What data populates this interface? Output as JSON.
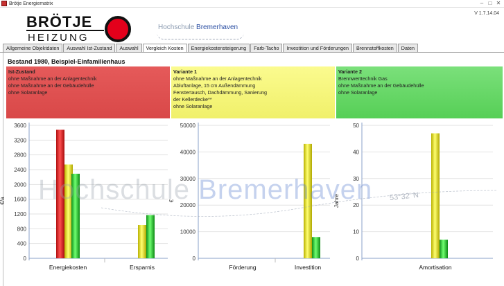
{
  "window": {
    "title": "Brötje Energiematrix",
    "controls": [
      "–",
      "□",
      "✕"
    ]
  },
  "header": {
    "logo_top": "BRÖTJE",
    "logo_bottom": "HEIZUNG",
    "hs_part1": "Hochschule",
    "hs_part2": "Bremerhaven",
    "version": "V 1.7.14.04"
  },
  "tabs": [
    {
      "label": "Allgemeine Objektdaten"
    },
    {
      "label": "Auswahl Ist-Zustand"
    },
    {
      "label": "Auswahl"
    },
    {
      "label": "Vergleich Kosten",
      "active": true
    },
    {
      "label": "Energiekostensteigerung"
    },
    {
      "label": "Farb-Tacho"
    },
    {
      "label": "Investition und Förderungen"
    },
    {
      "label": "Brennstoffkosten"
    },
    {
      "label": "Daten"
    }
  ],
  "page_title": "Bestand 1980, Beispiel-Einfamilienhaus",
  "panels": {
    "ist": {
      "title": "Ist-Zustand",
      "lines": [
        "ohne Maßnahme an der Anlagentechnik",
        "ohne Maßnahme an der Gebäudehülle",
        "ohne Solaranlage"
      ]
    },
    "v1": {
      "title": "Variante 1",
      "lines": [
        "ohne Maßnahme an der Anlagentechnik",
        "Abluftanlage, 15 cm Außendämmung",
        "Fenstertausch, Dachdämmung, Sanierung",
        "der Kellerdecke**",
        "ohne Solaranlage"
      ]
    },
    "v2": {
      "title": "Variante 2",
      "lines": [
        "Brennwerttechnik Gas",
        "ohne Maßnahme an der Gebäudehülle",
        "ohne Solaranlage"
      ]
    }
  },
  "watermark": {
    "part1": "Hochschule",
    "part2": "Bremerhaven",
    "coord": "53°32' N"
  },
  "colors": {
    "red": "#e02020",
    "yellow": "#e8e020",
    "green": "#30c030"
  },
  "chart_data": [
    {
      "type": "bar",
      "ylabel": "€/a",
      "ylim": [
        0,
        3600
      ],
      "yticks": [
        0,
        400,
        800,
        1200,
        1600,
        2000,
        2400,
        2800,
        3200,
        3600
      ],
      "categories": [
        "Energiekosten",
        "Ersparnis"
      ],
      "series": [
        {
          "color": "red",
          "values": [
            3480,
            0
          ]
        },
        {
          "color": "yellow",
          "values": [
            2540,
            900
          ]
        },
        {
          "color": "green",
          "values": [
            2290,
            1170
          ]
        }
      ]
    },
    {
      "type": "bar",
      "ylabel": "€",
      "ylim": [
        0,
        50000
      ],
      "yticks": [
        0,
        10000,
        20000,
        30000,
        40000,
        50000
      ],
      "categories": [
        "Förderung",
        "Investition"
      ],
      "series": [
        {
          "color": "red",
          "values": [
            0,
            0
          ]
        },
        {
          "color": "yellow",
          "values": [
            0,
            43000
          ]
        },
        {
          "color": "green",
          "values": [
            0,
            8000
          ]
        }
      ]
    },
    {
      "type": "bar",
      "ylabel": "Jahre",
      "ylim": [
        0,
        50
      ],
      "yticks": [
        0,
        10,
        20,
        30,
        40,
        50
      ],
      "categories": [
        "Amortisation"
      ],
      "series": [
        {
          "color": "red",
          "values": [
            0
          ]
        },
        {
          "color": "yellow",
          "values": [
            47
          ]
        },
        {
          "color": "green",
          "values": [
            7
          ]
        }
      ]
    }
  ]
}
